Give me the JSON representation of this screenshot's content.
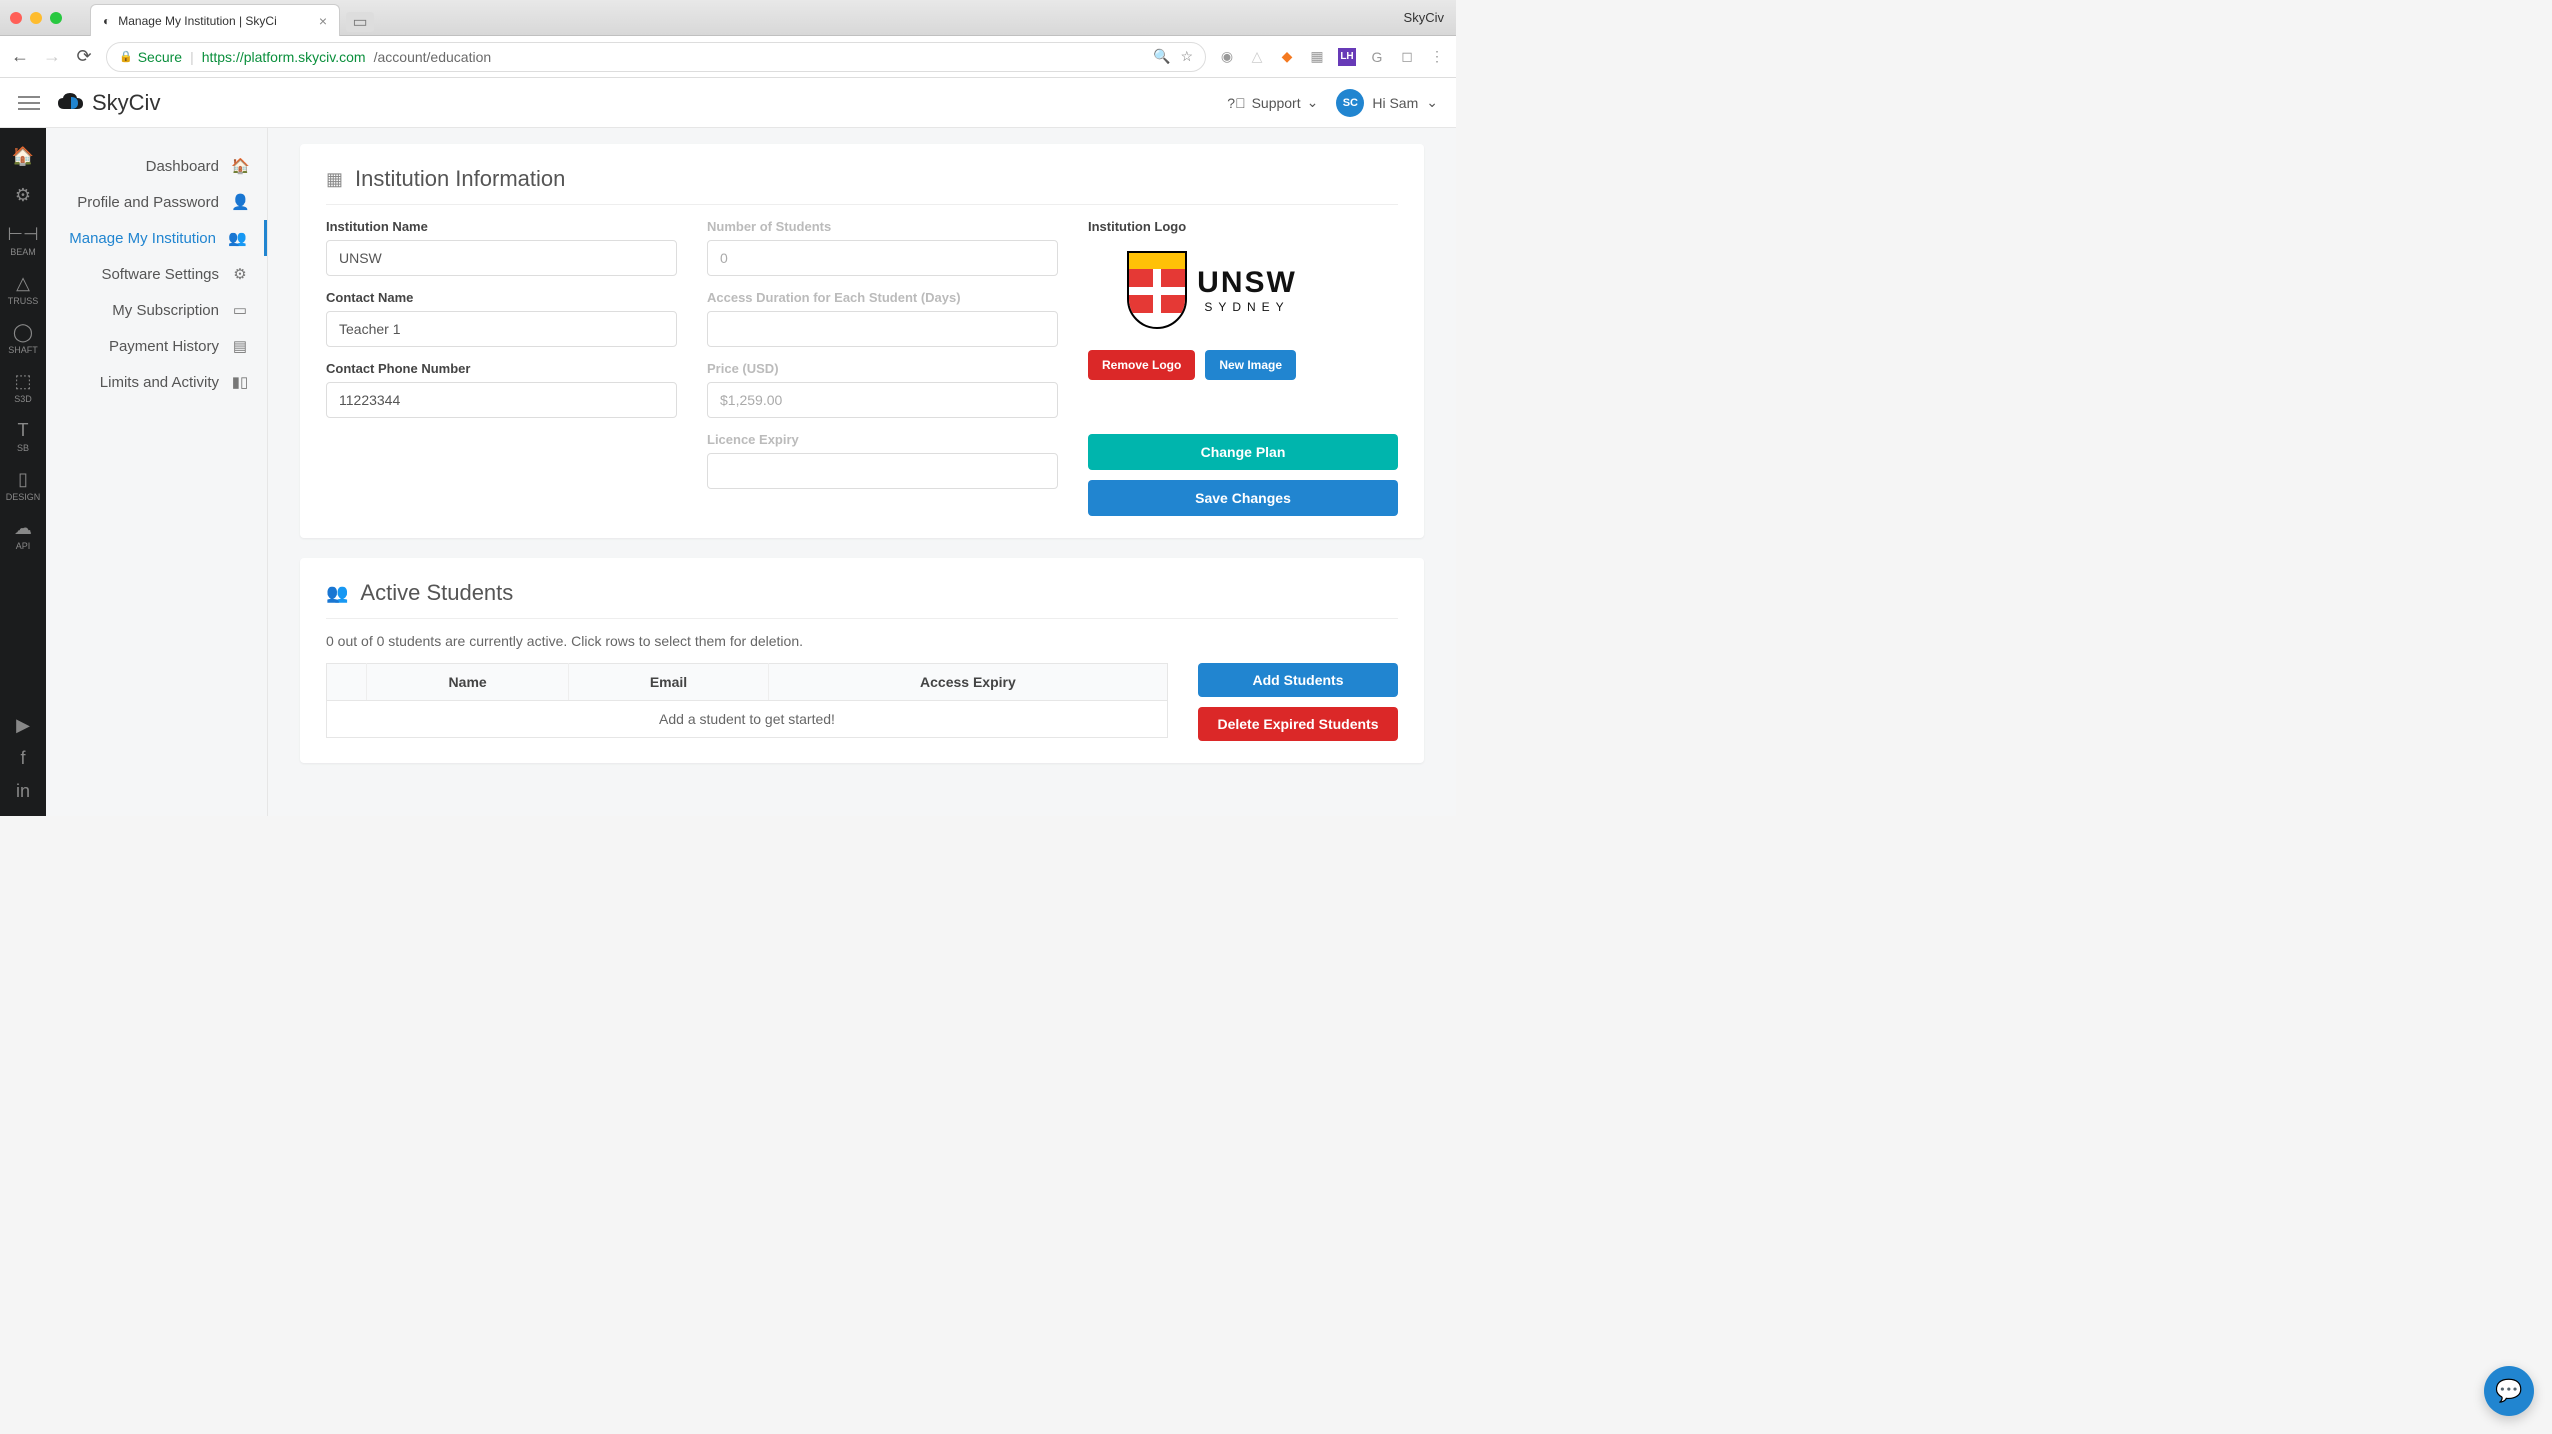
{
  "window": {
    "app_name": "SkyCiv",
    "tab_title": "Manage My Institution | SkyCi"
  },
  "browser": {
    "secure_label": "Secure",
    "url_host": "https://platform.skyciv.com",
    "url_path": "/account/education"
  },
  "header": {
    "logo_text": "SkyCiv",
    "support_label": "Support",
    "greeting": "Hi Sam",
    "avatar_initials": "SC"
  },
  "rail": [
    {
      "icon": "⌂",
      "label": ""
    },
    {
      "icon": "⚙",
      "label": ""
    },
    {
      "icon": "⊩",
      "label": "BEAM"
    },
    {
      "icon": "△",
      "label": "TRUSS"
    },
    {
      "icon": "⊖",
      "label": "SHAFT"
    },
    {
      "icon": "◧",
      "label": "S3D"
    },
    {
      "icon": "T",
      "label": "SB"
    },
    {
      "icon": "▤",
      "label": "DESIGN"
    },
    {
      "icon": "☁",
      "label": "API"
    }
  ],
  "settings_nav": [
    {
      "label": "Dashboard",
      "icon": "⌂"
    },
    {
      "label": "Profile and Password",
      "icon": "👤"
    },
    {
      "label": "Manage My Institution",
      "icon": "👥",
      "active": true
    },
    {
      "label": "Software Settings",
      "icon": "⚙"
    },
    {
      "label": "My Subscription",
      "icon": "▭"
    },
    {
      "label": "Payment History",
      "icon": "▤"
    },
    {
      "label": "Limits and Activity",
      "icon": "▮▮"
    }
  ],
  "institution": {
    "section_title": "Institution Information",
    "fields": {
      "name_label": "Institution Name",
      "name_value": "UNSW",
      "contact_label": "Contact Name",
      "contact_value": "Teacher 1",
      "phone_label": "Contact Phone Number",
      "phone_value": "11223344",
      "students_label": "Number of Students",
      "students_value": "0",
      "duration_label": "Access Duration for Each Student (Days)",
      "duration_value": "",
      "price_label": "Price (USD)",
      "price_value": "$1,259.00",
      "expiry_label": "Licence Expiry",
      "expiry_value": ""
    },
    "logo_label": "Institution Logo",
    "logo_text_big": "UNSW",
    "logo_text_small": "SYDNEY",
    "remove_logo": "Remove Logo",
    "new_image": "New Image",
    "change_plan": "Change Plan",
    "save_changes": "Save Changes"
  },
  "students": {
    "section_title": "Active Students",
    "subtext": "0 out of 0 students are currently active. Click rows to select them for deletion.",
    "cols": {
      "name": "Name",
      "email": "Email",
      "expiry": "Access Expiry"
    },
    "empty_row": "Add a student to get started!",
    "add_btn": "Add Students",
    "delete_btn": "Delete Expired Students"
  }
}
